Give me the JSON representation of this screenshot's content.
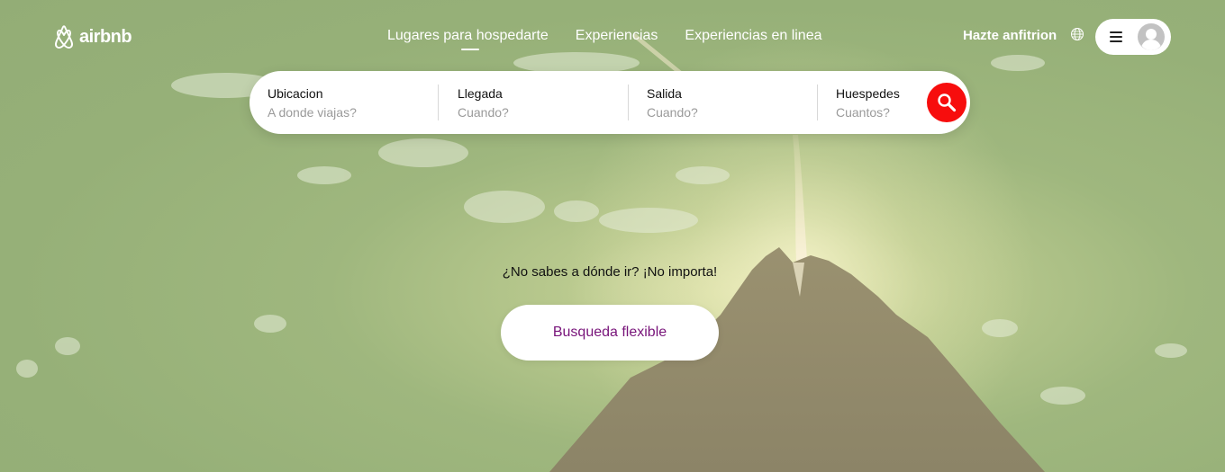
{
  "brand": {
    "name": "airbnb",
    "logo_icon": "airbnb-belo-icon"
  },
  "nav": {
    "links": [
      {
        "label": "Lugares para hospedarte"
      },
      {
        "label": "Experiencias"
      },
      {
        "label": "Experiencias en linea"
      }
    ],
    "host_label": "Hazte anfitrion",
    "globe_icon": "globe-icon",
    "menu_icon": "hamburger-menu-icon",
    "avatar_icon": "user-avatar-icon"
  },
  "search": {
    "fields": [
      {
        "label": "Ubicacion",
        "placeholder": "A donde viajas?"
      },
      {
        "label": "Llegada",
        "placeholder": "Cuando?"
      },
      {
        "label": "Salida",
        "placeholder": "Cuando?"
      },
      {
        "label": "Huespedes",
        "placeholder": "Cuantos?"
      }
    ],
    "button_icon": "search-icon",
    "button_color": "#f70d0d"
  },
  "flexible": {
    "tagline": "¿No sabes a dónde ir? ¡No importa!",
    "button_label": "Busqueda flexible",
    "button_text_color": "#78147a"
  }
}
